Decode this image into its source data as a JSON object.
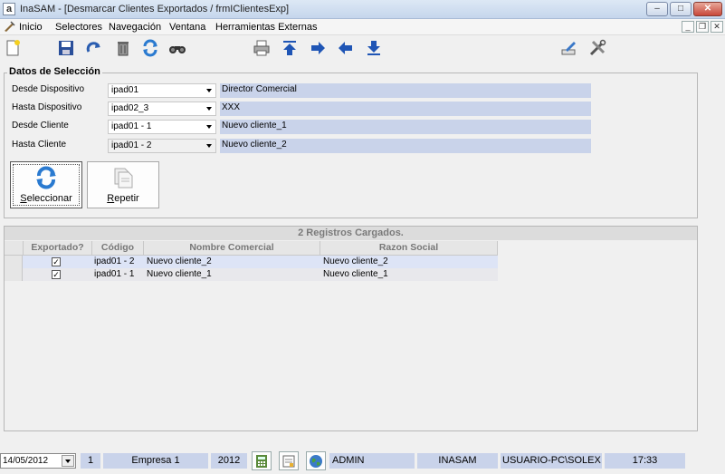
{
  "window": {
    "app_icon": "a",
    "title": "InaSAM - [Desmarcar Clientes Exportados / frmIClientesExp]",
    "minimize": "–",
    "maximize": "□",
    "close": "✕"
  },
  "menu": {
    "items": [
      "Inicio",
      "Selectores",
      "Navegación",
      "Ventana",
      "Herramientas Externas"
    ],
    "mdi_minimize": "_",
    "mdi_restore": "❐",
    "mdi_close": "✕"
  },
  "toolbar": {
    "icons": [
      "new-document-icon",
      "save-icon",
      "redo-icon",
      "delete-icon",
      "refresh-icon",
      "binoculars-icon",
      "print-icon",
      "arrow-up-first-icon",
      "arrow-right-icon",
      "arrow-left-icon",
      "arrow-down-last-icon",
      "settings-icon",
      "tools-icon"
    ]
  },
  "selection": {
    "legend": "Datos de Selección",
    "fields": [
      {
        "label": "Desde Dispositivo",
        "value": "ipad01",
        "description": "Director Comercial"
      },
      {
        "label": "Hasta Dispositivo",
        "value": "ipad02_3",
        "description": "XXX"
      },
      {
        "label": "Desde Cliente",
        "value": "ipad01 - 1",
        "description": "Nuevo cliente_1"
      },
      {
        "label": "Hasta Cliente",
        "value": "ipad01 - 2",
        "description": "Nuevo cliente_2"
      }
    ],
    "buttons": {
      "select_first": "S",
      "select_rest": "eleccionar",
      "repeat_first": "R",
      "repeat_rest": "epetir"
    }
  },
  "grid": {
    "caption": "2 Registros Cargados.",
    "columns": [
      "Exportado?",
      "Código",
      "Nombre Comercial",
      "Razon Social"
    ],
    "rows": [
      {
        "exported": "✓",
        "code": "ipad01 - 2",
        "name": "Nuevo cliente_2",
        "social": "Nuevo cliente_2"
      },
      {
        "exported": "✓",
        "code": "ipad01 - 1",
        "name": "Nuevo cliente_1",
        "social": "Nuevo cliente_1"
      }
    ]
  },
  "status": {
    "date": "14/05/2012",
    "number": "1",
    "company": "Empresa 1",
    "year": "2012",
    "user": "ADMIN",
    "db": "INASAM",
    "machine": "USUARIO-PC\\SOLEX",
    "time": "17:33"
  },
  "colors": {
    "panel_blue": "#c9d3ea",
    "selected_row": "#dde4f6",
    "alt_row": "#e8e8ec"
  }
}
